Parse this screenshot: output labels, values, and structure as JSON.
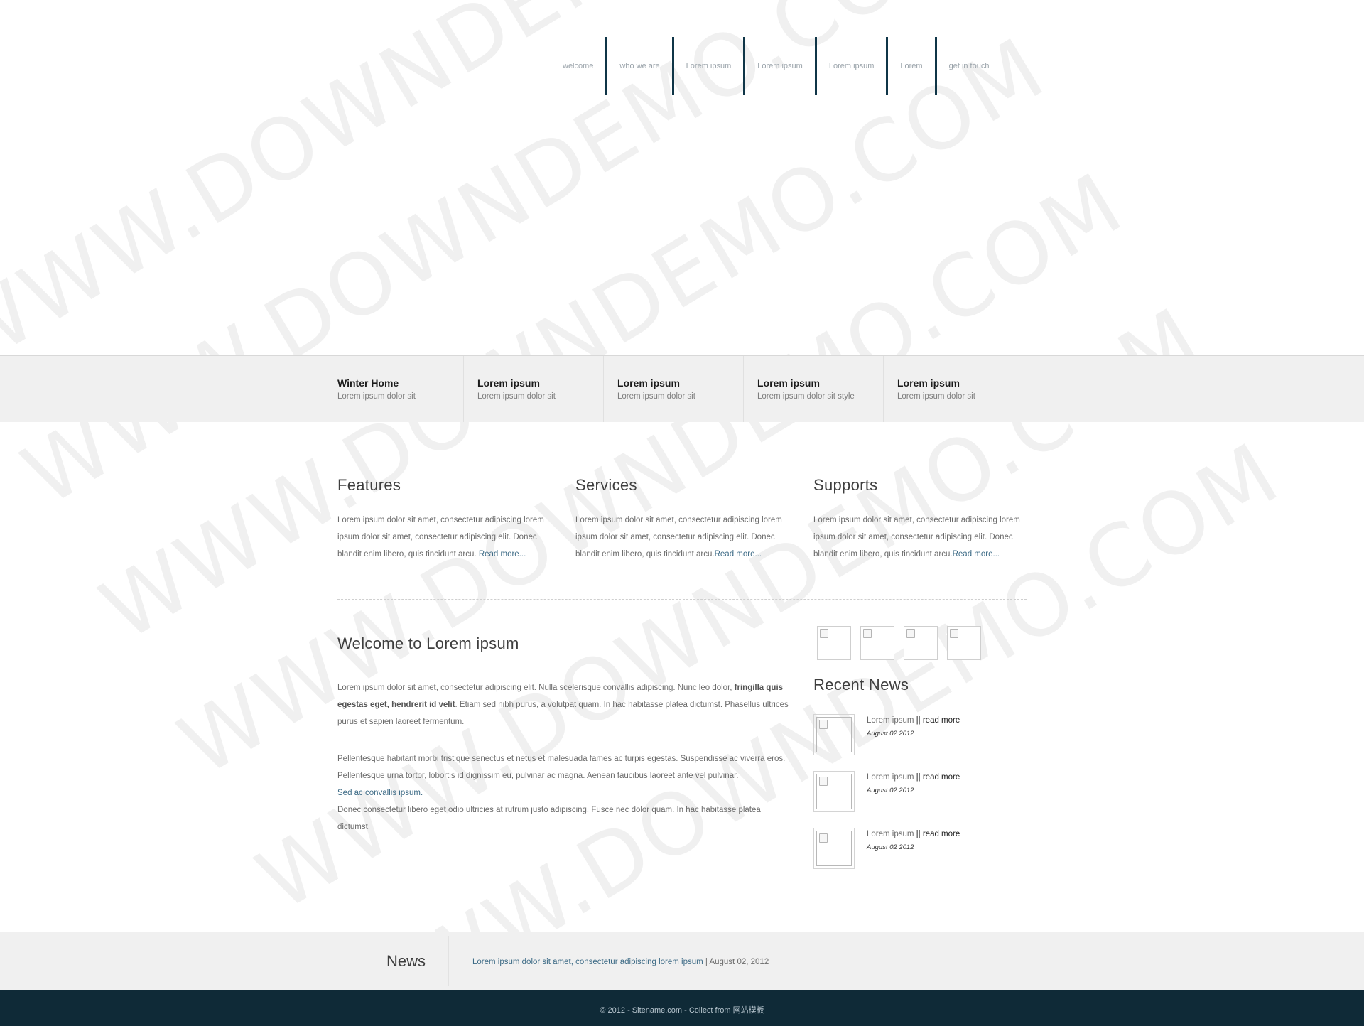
{
  "nav": {
    "items": [
      "welcome",
      "who we are",
      "Lorem ipsum",
      "Lorem ipsum",
      "Lorem ipsum",
      "Lorem",
      "get in touch"
    ],
    "separator_color": "#0f3547"
  },
  "feature_bar": [
    {
      "title": "Winter Home",
      "subtitle": "Lorem ipsum dolor sit"
    },
    {
      "title": "Lorem ipsum",
      "subtitle": "Lorem ipsum dolor sit"
    },
    {
      "title": "Lorem ipsum",
      "subtitle": "Lorem ipsum dolor sit"
    },
    {
      "title": "Lorem ipsum",
      "subtitle": "Lorem ipsum dolor sit style"
    },
    {
      "title": "Lorem ipsum",
      "subtitle": "Lorem ipsum dolor sit"
    }
  ],
  "columns": [
    {
      "title": "Features",
      "text": "Lorem ipsum dolor sit amet, consectetur adipiscing lorem ipsum dolor sit amet, consectetur adipiscing elit. Donec blandit enim libero, quis tincidunt arcu. ",
      "link": "Read more..."
    },
    {
      "title": "Services",
      "text": "Lorem ipsum dolor sit amet, consectetur adipiscing lorem ipsum dolor sit amet, consectetur adipiscing elit. Donec blandit enim libero, quis tincidunt arcu.",
      "link": "Read more..."
    },
    {
      "title": "Supports",
      "text": "Lorem ipsum dolor sit amet, consectetur adipiscing lorem ipsum dolor sit amet, consectetur adipiscing elit. Donec blandit enim libero, quis tincidunt arcu.",
      "link": "Read more..."
    }
  ],
  "welcome": {
    "title": "Welcome to Lorem ipsum",
    "p1_start": "Lorem ipsum dolor sit amet, consectetur adipiscing elit. Nulla scelerisque convallis adipiscing. Nunc leo dolor, ",
    "p1_bold": "fringilla quis egestas eget, hendrerit id velit",
    "p1_end": ". Etiam sed nibh purus, a volutpat quam. In hac habitasse platea dictumst. Phasellus ultrices purus et sapien laoreet fermentum.",
    "p2_start": "Pellentesque habitant morbi tristique senectus et netus et malesuada fames ac turpis egestas. Suspendisse ac viverra eros. Pellentesque urna tortor, lobortis id dignissim eu, pulvinar ac magna. Aenean faucibus laoreet ante vel pulvinar.",
    "p2_link": "Sed ac convallis ipsum.",
    "p2_end": "Donec consectetur libero eget odio ultricies at rutrum justo adipiscing. Fusce nec dolor quam. In hac habitasse platea dictumst."
  },
  "recent_news": {
    "title": "Recent News",
    "items": [
      {
        "title": "Lorem ipsum",
        "more": "|| read more",
        "date": "August 02 2012"
      },
      {
        "title": "Lorem ipsum",
        "more": "|| read more",
        "date": "August 02 2012"
      },
      {
        "title": "Lorem ipsum",
        "more": "|| read more",
        "date": "August 02 2012"
      }
    ]
  },
  "news_strip": {
    "label": "News",
    "link": "Lorem ipsum dolor sit amet, consectetur adipiscing lorem ipsum",
    "date": " | August 02, 2012"
  },
  "footer": {
    "text": "© 2012 - Sitename.com - Collect from 网站模板"
  },
  "watermark": {
    "text": "WWW.DOWNDEMO.COM"
  }
}
